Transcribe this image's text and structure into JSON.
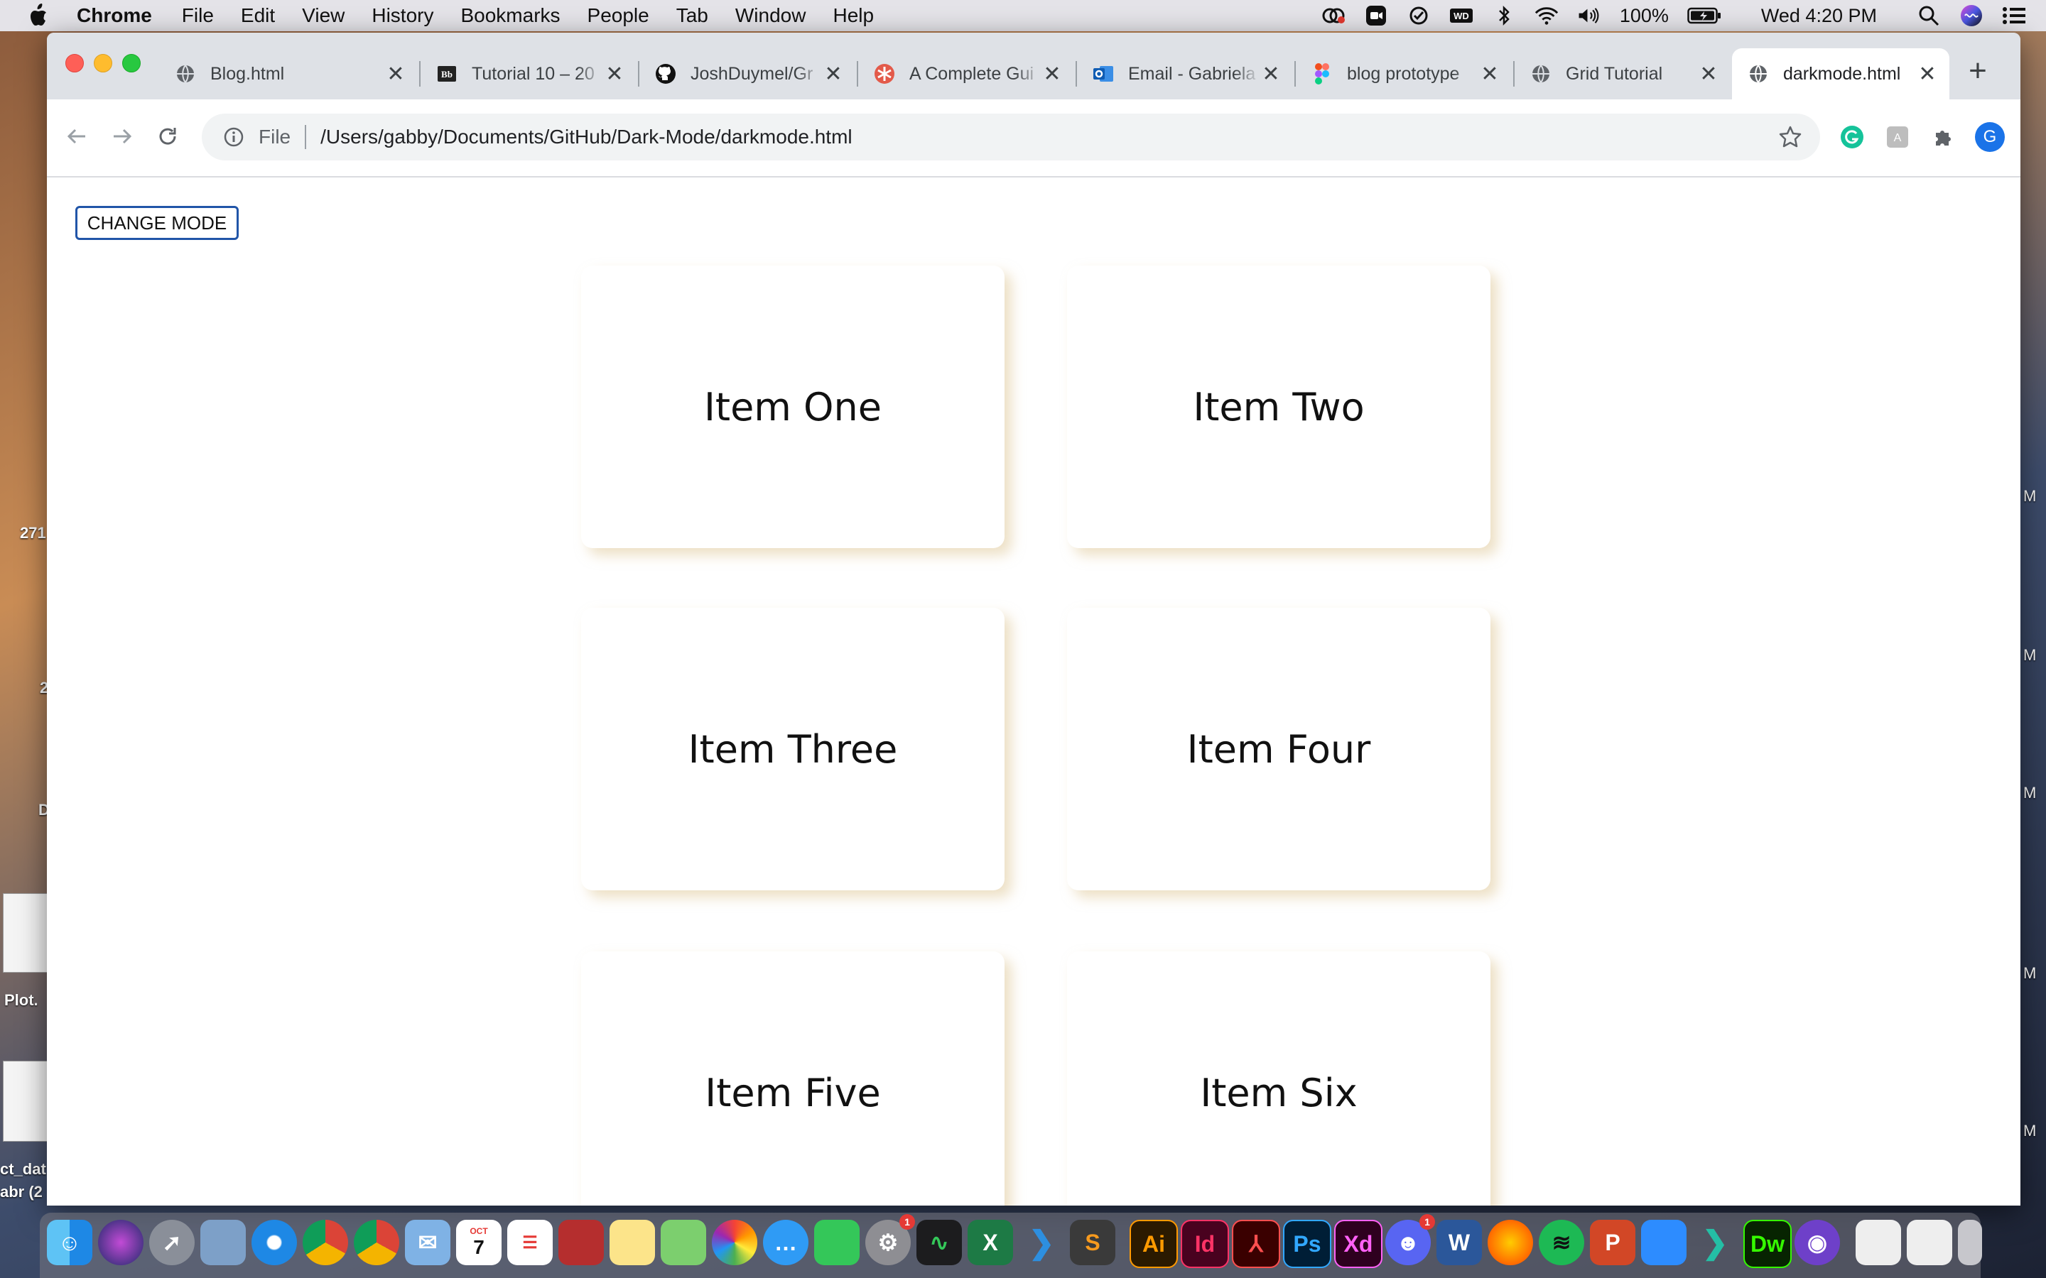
{
  "menubar": {
    "app": "Chrome",
    "items": [
      "File",
      "Edit",
      "View",
      "History",
      "Bookmarks",
      "People",
      "Tab",
      "Window",
      "Help"
    ],
    "battery": "100%",
    "clock": "Wed 4:20 PM"
  },
  "desktop": {
    "fragment_1": "271",
    "fragment_2": "2",
    "fragment_3": "D",
    "file_1": "Plot.",
    "file_2_line1": "ct_dat",
    "file_2_line2": "abr (2",
    "right_m": "M"
  },
  "tabs": [
    {
      "title": "Blog.html",
      "icon": "globe-icon"
    },
    {
      "title": "Tutorial 10 – 20",
      "icon": "blackboard-icon"
    },
    {
      "title": "JoshDuymel/Gr",
      "icon": "github-icon"
    },
    {
      "title": "A Complete Gui",
      "icon": "asterisk-icon"
    },
    {
      "title": "Email - Gabriela",
      "icon": "outlook-icon"
    },
    {
      "title": "blog prototype",
      "icon": "figma-icon"
    },
    {
      "title": "Grid Tutorial",
      "icon": "globe-icon"
    },
    {
      "title": "darkmode.html",
      "icon": "globe-icon",
      "active": true
    }
  ],
  "toolbar": {
    "scheme": "File",
    "url": "/Users/gabby/Documents/GitHub/Dark-Mode/darkmode.html",
    "profile_initial": "G"
  },
  "page": {
    "mode_button": "CHANGE MODE",
    "cards": [
      "Item One",
      "Item Two",
      "Item Three",
      "Item Four",
      "Item Five",
      "Item Six"
    ]
  },
  "colors": {
    "accent_border": "#2155a8",
    "card_shadow": "#dec696",
    "grammarly": "#15c39a",
    "profile": "#1a73e8"
  },
  "dock": {
    "apps": [
      "Finder",
      "Siri",
      "Launchpad",
      "Preview",
      "Safari",
      "Chrome",
      "Chrome Canary",
      "Mail",
      "Calendar",
      "Reminders",
      "Photo Booth",
      "Notes",
      "Maps",
      "Photos",
      "Messages",
      "FaceTime",
      "System Preferences",
      "Activity Monitor",
      "Excel",
      "VS Code",
      "Sublime Text",
      "Illustrator",
      "InDesign",
      "Acrobat",
      "Photoshop",
      "XD",
      "Discord",
      "Word",
      "Firefox",
      "Spotify",
      "PowerPoint",
      "Zoom",
      "VS Code Insiders",
      "Dreamweaver",
      "GitHub Desktop",
      "Window 1",
      "Window 2",
      "Trash"
    ],
    "calendar_month": "OCT",
    "calendar_day": "7",
    "ai_label": "Ai",
    "id_label": "Id",
    "ps_label": "Ps",
    "xd_label": "Xd",
    "dw_label": "Dw",
    "w_label": "W",
    "p_label": "P",
    "x_label": "X",
    "badge_sys": "1",
    "badge_discord": "1"
  }
}
